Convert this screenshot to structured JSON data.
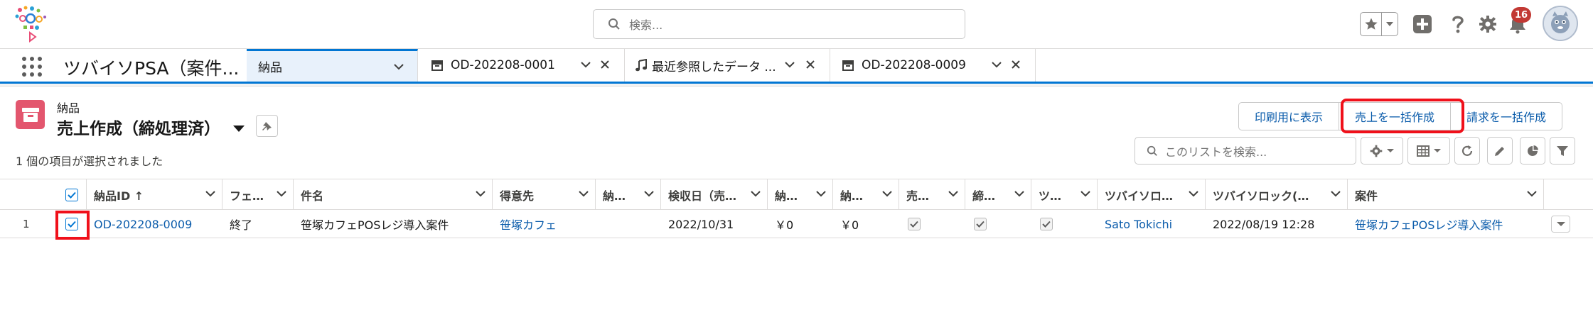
{
  "colors": {
    "brand": "#0176d3",
    "link": "#0b5cab",
    "highlight": "#f0101a",
    "object_icon": "#e3566e",
    "badge": "#c23934"
  },
  "header": {
    "logo_icon": "app-logo",
    "search_placeholder": "検索...",
    "notification_count": "16"
  },
  "navigation": {
    "app_name": "ツバイソPSA（案件...",
    "tabs": [
      {
        "label": "納品",
        "icon": "",
        "active": true
      },
      {
        "label": "OD-202208-0001",
        "icon": "record-icon",
        "active": false
      },
      {
        "label": "最近参照したデータ ...",
        "icon": "music-note-icon",
        "active": false
      },
      {
        "label": "OD-202208-0009",
        "icon": "record-icon",
        "active": false
      }
    ]
  },
  "list_view": {
    "object_label": "納品",
    "title": "売上作成（締処理済）",
    "selection_info": "1 個の項目が選択されました",
    "buttons": [
      "印刷用に表示",
      "売上を一括作成",
      "請求を一括作成"
    ],
    "search_placeholder": "このリストを検索..."
  },
  "table": {
    "columns": [
      "納品ID ↑",
      "フェ…",
      "件名",
      "得意先",
      "納…",
      "検収日（売…",
      "納…",
      "納…",
      "売…",
      "締…",
      "ツ…",
      "ツバイソロ…",
      "ツバイソロック(…",
      "案件"
    ],
    "rows": [
      {
        "num": "1",
        "selected": true,
        "id": "OD-202208-0009",
        "phase": "終了",
        "subject": "笹塚カフェPOSレジ導入案件",
        "customer": "笹塚カフェ",
        "col5": "",
        "inspection_date": "2022/10/31",
        "amount1": "￥0",
        "amount2": "￥0",
        "check1": true,
        "check2": true,
        "check3": true,
        "lock_user": "Sato Tokichi",
        "lock_time": "2022/08/19 12:28",
        "project": "笹塚カフェPOSレジ導入案件"
      }
    ]
  }
}
